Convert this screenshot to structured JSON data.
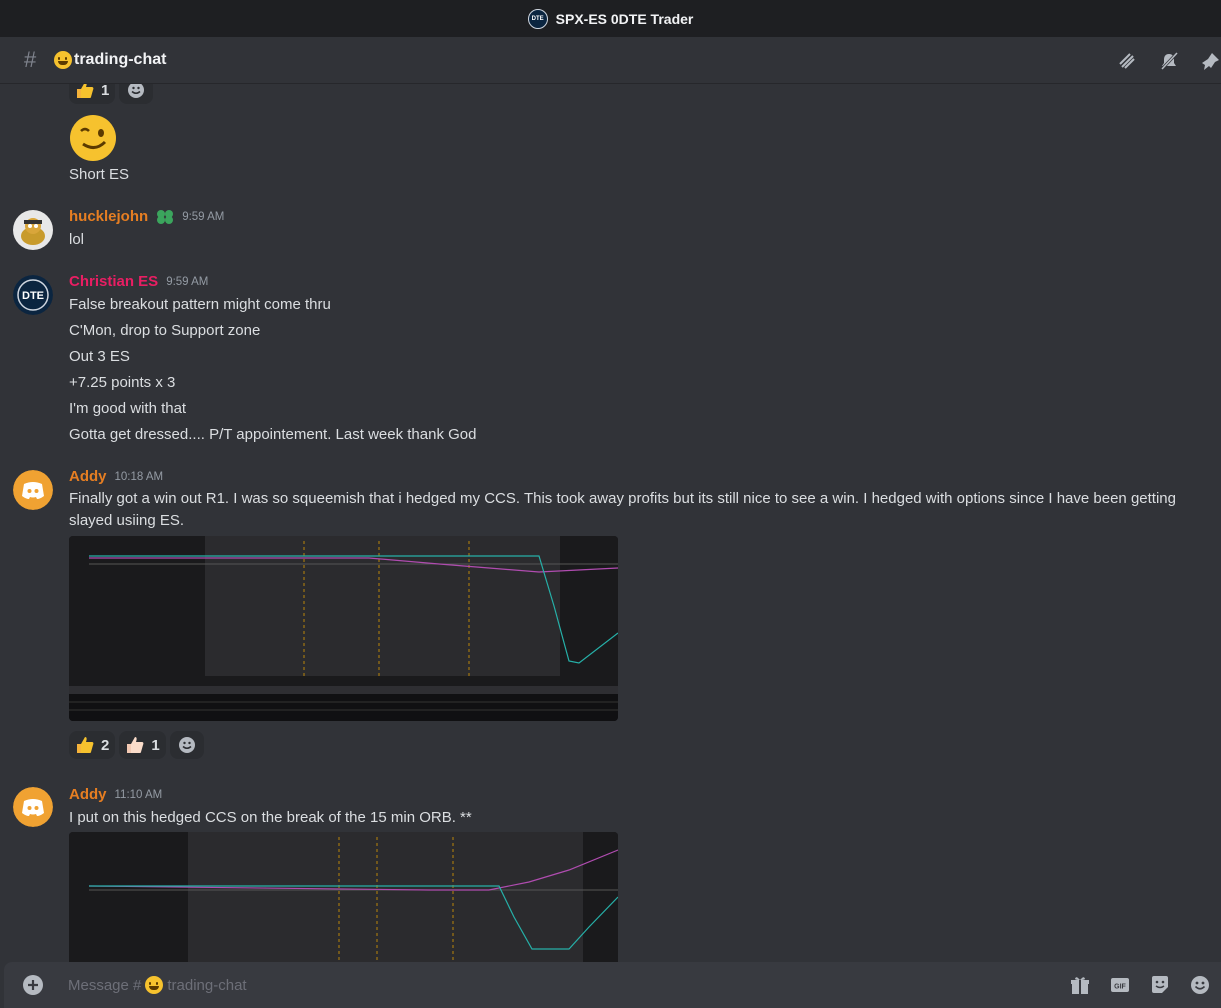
{
  "window": {
    "title": "SPX-ES 0DTE Trader",
    "logo_text": "DTE"
  },
  "channel": {
    "name": "trading-chat"
  },
  "top_reactions": {
    "thumbs_count": "1"
  },
  "messages": [
    {
      "text": "Short ES"
    },
    {
      "user": "hucklejohn",
      "time": "9:59 AM",
      "color": "#e67e22",
      "lines": [
        "lol"
      ]
    },
    {
      "user": "Christian ES",
      "time": "9:59 AM",
      "color": "#e91e63",
      "lines": [
        "False breakout pattern might come thru",
        "C'Mon, drop to Support zone",
        "Out 3 ES",
        "+7.25 points x 3",
        "I'm good with that",
        "Gotta get dressed.... P/T appointement. Last week thank God"
      ]
    },
    {
      "user": "Addy",
      "time": "10:18 AM",
      "color": "#e67e22",
      "lines": [
        "Finally got a win out R1.   I was so squeemish that i hedged my CCS.  This took away profits but its still nice to see a win.   I hedged with options since I have been getting",
        "slayed usiing ES."
      ],
      "reactions": {
        "thumbs_count": "2",
        "thumbs_light_count": "1"
      }
    },
    {
      "user": "Addy",
      "time": "11:10 AM",
      "color": "#e67e22",
      "lines": [
        "I put on this hedged CCS on the break of the 15 min ORB.  **"
      ]
    }
  ],
  "composer": {
    "placeholder_prefix": "Message #",
    "placeholder_channel": "trading-chat"
  },
  "colors": {
    "accent": "#5865f2",
    "discord_orange": "#f0a232"
  }
}
